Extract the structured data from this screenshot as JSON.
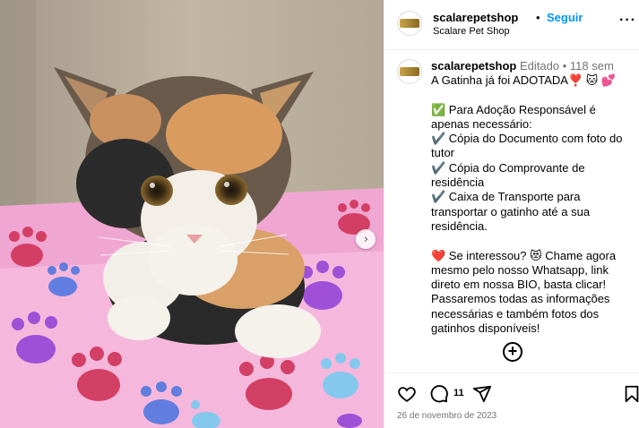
{
  "post": {
    "username": "scalarepetshop",
    "follow_label": "Seguir",
    "separator": "•",
    "location": "Scalare Pet Shop",
    "more_icon": "more-horizontal-icon"
  },
  "caption": {
    "username": "scalarepetshop",
    "edited": "Editado",
    "separator": "•",
    "age": "118 sem",
    "line1": "A Gatinha já foi ADOTADA❣️ 🐱 💕",
    "body": "✅ Para Adoção Responsável é apenas necessário:\n✔️ Cópia do Documento com foto do tutor\n✔️ Cópia do Comprovante de residência\n✔️ Caixa de Transporte para transportar o gatinho até a sua residência.\n\n❤️ Se interessou? 😻 Chame agora mesmo pelo nosso Whatsapp, link direto em nossa BIO, basta clicar! Passaremos todas as informações necessárias e também fotos dos gatinhos disponíveis!"
  },
  "actions": {
    "comment_count": "11",
    "date": "26 de novembro de 2023"
  },
  "icons": {
    "like": "heart-icon",
    "comment": "comment-icon",
    "share": "send-icon",
    "save": "bookmark-icon",
    "add": "add-circle-icon",
    "next": "chevron-right-icon"
  },
  "colors": {
    "link_blue": "#0095f6",
    "meta_gray": "#737373",
    "divider": "#efefef"
  }
}
